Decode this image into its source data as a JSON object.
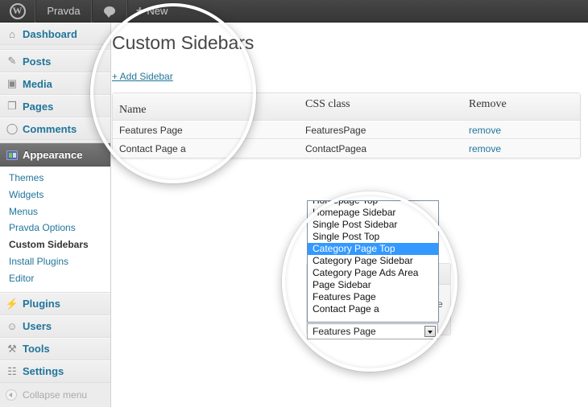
{
  "adminbar": {
    "wp_icon": "wordpress-logo-icon",
    "site_name": "Pravda",
    "comments_icon": "comment-bubble-icon",
    "new_label": "New",
    "new_icon": "plus-icon"
  },
  "sidebar": {
    "items": [
      {
        "label": "Dashboard",
        "icon": "home-icon"
      },
      {
        "label": "Posts",
        "icon": "pushpin-icon"
      },
      {
        "label": "Media",
        "icon": "media-icon"
      },
      {
        "label": "Pages",
        "icon": "pages-icon"
      },
      {
        "label": "Comments",
        "icon": "comment-icon"
      },
      {
        "label": "Appearance",
        "icon": "appearance-icon",
        "current": true
      },
      {
        "label": "Plugins",
        "icon": "plug-icon"
      },
      {
        "label": "Users",
        "icon": "users-icon"
      },
      {
        "label": "Tools",
        "icon": "tools-icon"
      },
      {
        "label": "Settings",
        "icon": "settings-icon"
      }
    ],
    "submenu": [
      {
        "label": "Themes"
      },
      {
        "label": "Widgets"
      },
      {
        "label": "Menus"
      },
      {
        "label": "Pravda Options"
      },
      {
        "label": "Custom Sidebars",
        "current": true
      },
      {
        "label": "Install Plugins"
      },
      {
        "label": "Editor"
      }
    ],
    "collapse_label": "Collapse menu"
  },
  "main": {
    "title": "Custom Sidebars",
    "add_link": "+ Add Sidebar",
    "table": {
      "headers": [
        "Name",
        "CSS class",
        "Remove"
      ],
      "rows": [
        {
          "name": "Features Page",
          "css_class": "FeaturesPage",
          "action": "remove"
        },
        {
          "name": "Contact Page a",
          "css_class": "ContactPagea",
          "action": "remove"
        }
      ]
    }
  },
  "widget": {
    "partial_text": "ve",
    "select": {
      "value": "Features Page",
      "options": [
        "Homepage Top",
        "Homepage Sidebar",
        "Single Post Sidebar",
        "Single Post Top",
        "Category Page Top",
        "Category Page Sidebar",
        "Category Page Ads Area",
        "Page Sidebar",
        "Features Page",
        "Contact Page a"
      ],
      "highlighted": "Category Page Top"
    }
  },
  "colors": {
    "link": "#21759b",
    "adminbar": "#464646",
    "current_menu": "#6d6d6d",
    "highlight": "#3399ff"
  }
}
